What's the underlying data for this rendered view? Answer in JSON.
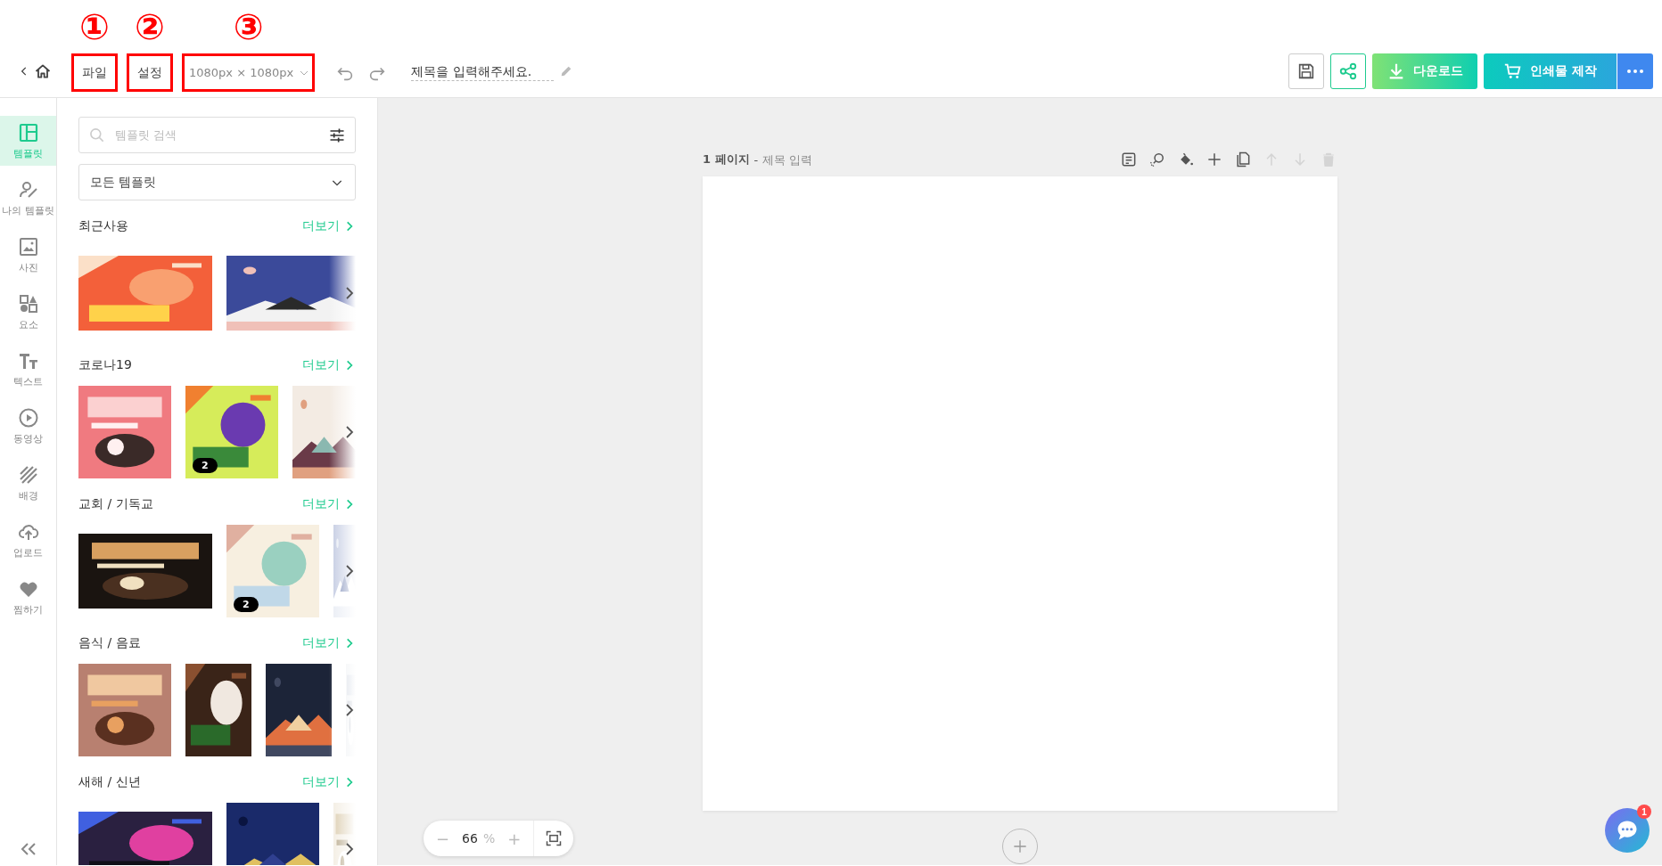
{
  "topbar": {
    "menu": [
      {
        "label": "파일",
        "annotation": "①"
      },
      {
        "label": "설정",
        "annotation": "②"
      }
    ],
    "canvas_size": {
      "value": "1080px × 1080px",
      "annotation": "③"
    },
    "title_placeholder": "제목을 입력해주세요.",
    "buttons": [
      {
        "kind": "save"
      },
      {
        "kind": "share"
      },
      {
        "kind": "download",
        "label": "다운로드"
      },
      {
        "kind": "print",
        "label": "인쇄물 제작"
      },
      {
        "kind": "more"
      }
    ]
  },
  "sidebar": {
    "items": [
      {
        "label": "템플릿",
        "selected": true
      },
      {
        "label": "나의 템플릿",
        "selected": false
      },
      {
        "label": "사진",
        "selected": false
      },
      {
        "label": "요소",
        "selected": false
      },
      {
        "label": "텍스트",
        "selected": false
      },
      {
        "label": "동영상",
        "selected": false
      },
      {
        "label": "배경",
        "selected": false
      },
      {
        "label": "업로드",
        "selected": false
      },
      {
        "label": "찜하기",
        "selected": false
      }
    ]
  },
  "panel": {
    "search": {
      "placeholder": "템플릿 검색"
    },
    "filter": {
      "value": "모든 템플릿"
    },
    "sections": [
      {
        "title": "최근사용",
        "more": "더보기",
        "thumbnails": [
          {
            "kind": "picture"
          },
          {
            "kind": "picture"
          }
        ]
      },
      {
        "title": "코로나19",
        "more": "더보기",
        "thumbnails": [
          {
            "kind": "picture"
          },
          {
            "kind": "picture",
            "badge": "2"
          },
          {
            "kind": "picture"
          }
        ]
      },
      {
        "title": "교회 / 기독교",
        "more": "더보기",
        "thumbnails": [
          {
            "kind": "picture"
          },
          {
            "kind": "picture",
            "badge": "2"
          },
          {
            "kind": "picture"
          }
        ]
      },
      {
        "title": "음식 / 음료",
        "more": "더보기",
        "thumbnails": [
          {
            "kind": "picture"
          },
          {
            "kind": "picture"
          },
          {
            "kind": "picture"
          },
          {
            "kind": "picture"
          }
        ]
      },
      {
        "title": "새해 / 신년",
        "more": "더보기",
        "thumbnails": [
          {
            "kind": "picture"
          },
          {
            "kind": "picture"
          },
          {
            "kind": "picture"
          }
        ]
      }
    ]
  },
  "page": {
    "number": "1 페이지",
    "separator": "-",
    "title_placeholder": "제목 입력",
    "tools": [
      {
        "disabled": false
      },
      {
        "disabled": false
      },
      {
        "disabled": false
      },
      {
        "disabled": false
      },
      {
        "disabled": false
      },
      {
        "disabled": true
      },
      {
        "disabled": true
      },
      {
        "disabled": true
      }
    ]
  },
  "zoom": {
    "minus": "−",
    "value": "66",
    "unit": "%",
    "plus": "+"
  },
  "chat": {
    "badge": "1"
  }
}
